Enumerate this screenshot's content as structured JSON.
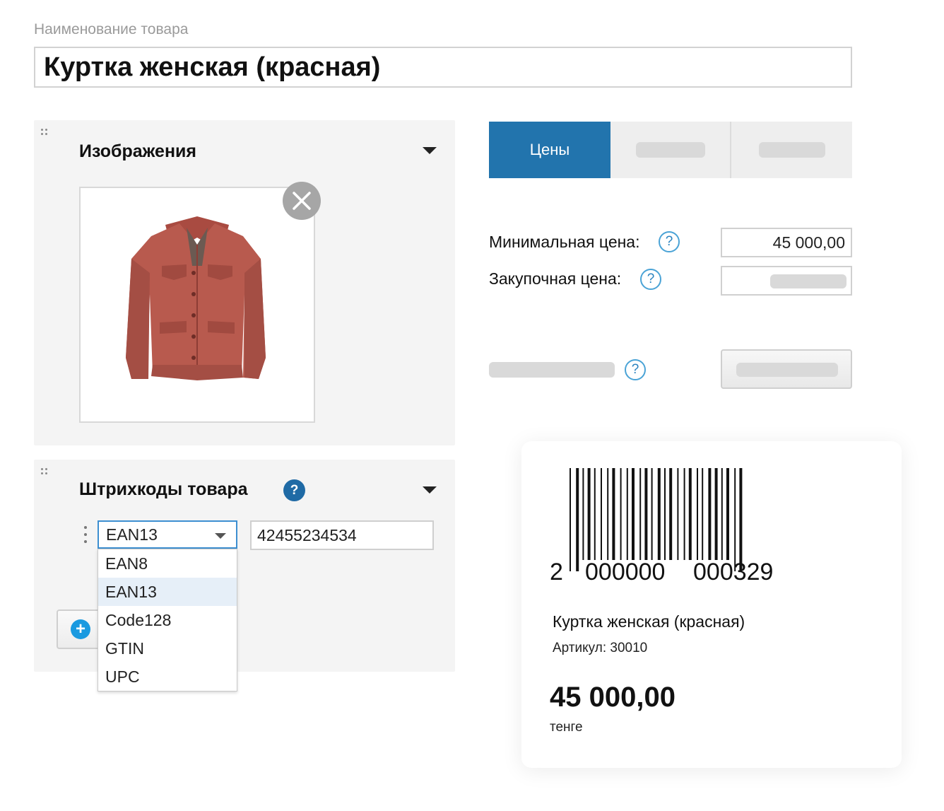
{
  "product": {
    "name_label": "Наименование товара",
    "name_value": "Куртка женская (красная)"
  },
  "images": {
    "title": "Изображения",
    "photo": "red-leather-jacket-photo",
    "remove_icon": "close-icon"
  },
  "tabs": {
    "active_label": "Цены"
  },
  "prices": {
    "min_label": "Минимальная цена:",
    "min_value": "45 000,00",
    "purchase_label": "Закупочная цена:",
    "help_glyph": "?"
  },
  "barcodes": {
    "title": "Штрихкоды товара",
    "help_glyph": "?",
    "selected_type": "EAN13",
    "code_value": "42455234534",
    "options": [
      "EAN8",
      "EAN13",
      "Code128",
      "GTIN",
      "UPC"
    ],
    "add_icon": "plus-icon"
  },
  "label": {
    "barcode_digits": [
      "2",
      "000000",
      "000329"
    ],
    "product_name": "Куртка женская (красная)",
    "sku": "Артикул: 30010",
    "price": "45 000,00",
    "currency": "тенге"
  },
  "colors": {
    "accent": "#2274ad",
    "help": "#2b83bf",
    "panel_bg": "#f4f4f4",
    "jacket": "#b85a4e"
  }
}
